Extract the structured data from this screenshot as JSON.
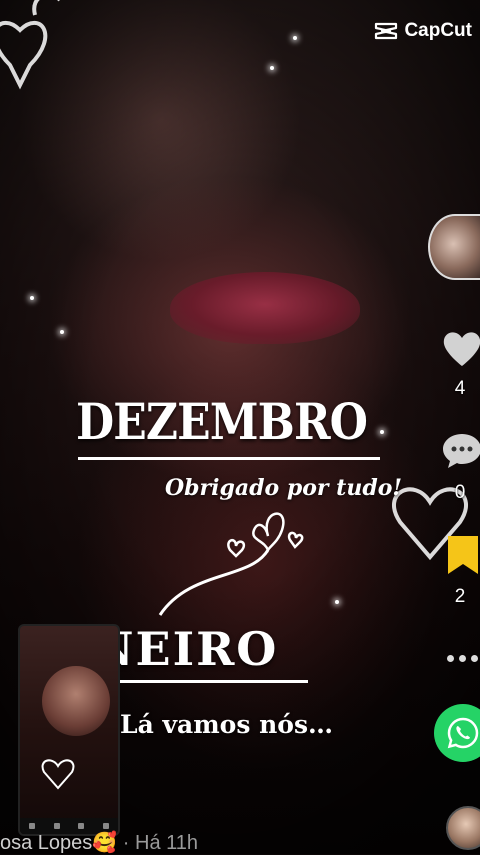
{
  "watermark": {
    "brand": "CapCut"
  },
  "overlay": {
    "month_1": "DEZEMBRO",
    "message_1": "Obrigado por tudo!",
    "month_2": "JANEIRO",
    "message_2": "Lá vamos nós…"
  },
  "actions": {
    "likes": "4",
    "comments": "0",
    "saves": "2"
  },
  "footer": {
    "username": "osa Lopes",
    "emoji": "🥰",
    "separator": "·",
    "time": "Há 11h"
  },
  "icons": [
    "capcut-logo-icon",
    "heart-icon",
    "comment-icon",
    "bookmark-icon",
    "more-icon",
    "whatsapp-icon"
  ],
  "colors": {
    "accent_save": "#f5c518",
    "whatsapp": "#25d366",
    "text": "#ffffff"
  }
}
